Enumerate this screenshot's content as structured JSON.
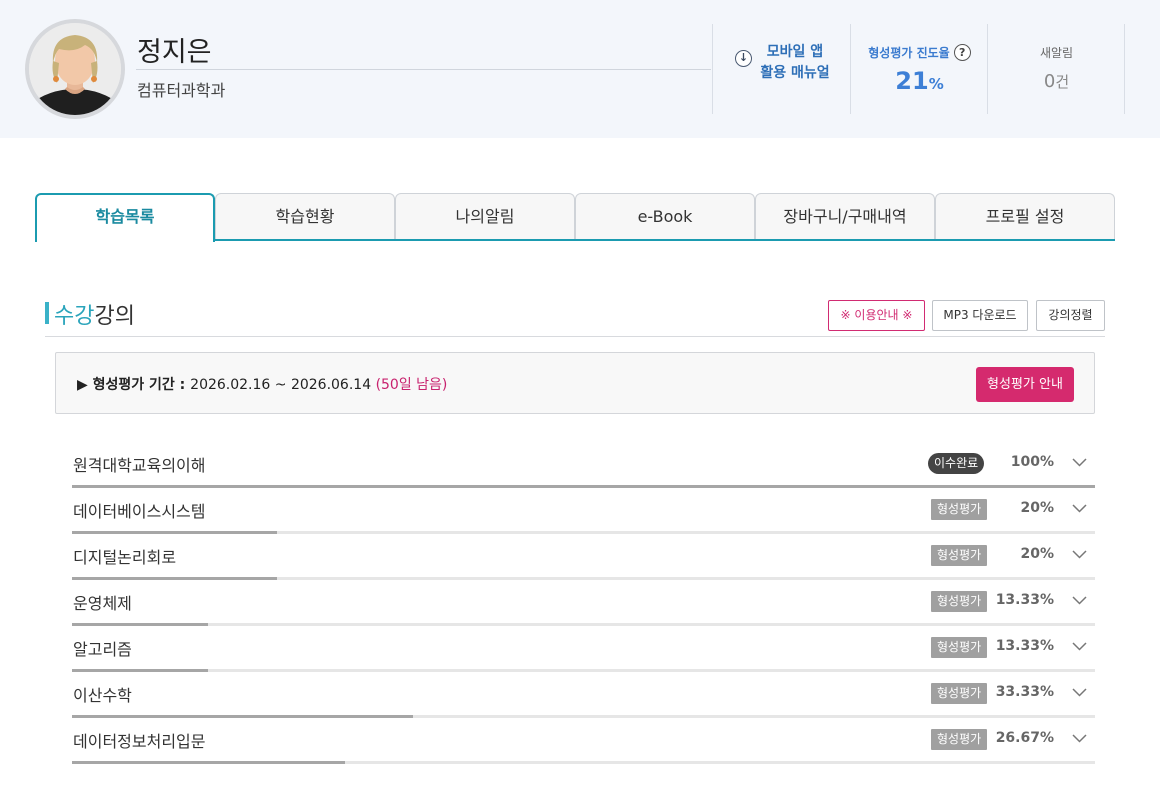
{
  "profile": {
    "name": "정지은",
    "department": "컴퓨터과학과"
  },
  "mobile_manual": {
    "line1": "모바일 앱",
    "line2": "활용 매뉴얼",
    "icon": "download-circle-icon"
  },
  "progress": {
    "label": "형성평가 진도율",
    "value": "21",
    "unit": "%"
  },
  "notifications": {
    "label": "새알림",
    "value": "0",
    "unit": "건"
  },
  "tabs": [
    {
      "label": "학습목록",
      "active": true
    },
    {
      "label": "학습현황",
      "active": false
    },
    {
      "label": "나의알림",
      "active": false
    },
    {
      "label": "e-Book",
      "active": false
    },
    {
      "label": "장바구니/구매내역",
      "active": false
    },
    {
      "label": "프로필 설정",
      "active": false
    }
  ],
  "section": {
    "title_accent": "수강",
    "title_rest": "강의",
    "btn_guide": "※ 이용안내 ※",
    "btn_mp3": "MP3 다운로드",
    "btn_sort": "강의정렬"
  },
  "period": {
    "label": "▶ 형성평가 기간 : ",
    "dates": "2026.02.16 ~ 2026.06.14 ",
    "remain": "(50일 남음)",
    "button": "형성평가 안내"
  },
  "courses": [
    {
      "name": "원격대학교육의이해",
      "badge": "이수완료",
      "badge_type": "done",
      "percent_text": "100%",
      "progress": 1.0
    },
    {
      "name": "데이터베이스시스템",
      "badge": "형성평가",
      "badge_type": "eval",
      "percent_text": "20%",
      "progress": 0.2
    },
    {
      "name": "디지털논리회로",
      "badge": "형성평가",
      "badge_type": "eval",
      "percent_text": "20%",
      "progress": 0.2
    },
    {
      "name": "운영체제",
      "badge": "형성평가",
      "badge_type": "eval",
      "percent_text": "13.33%",
      "progress": 0.1333
    },
    {
      "name": "알고리즘",
      "badge": "형성평가",
      "badge_type": "eval",
      "percent_text": "13.33%",
      "progress": 0.1333
    },
    {
      "name": "이산수학",
      "badge": "형성평가",
      "badge_type": "eval",
      "percent_text": "33.33%",
      "progress": 0.3333
    },
    {
      "name": "데이터정보처리입문",
      "badge": "형성평가",
      "badge_type": "eval",
      "percent_text": "26.67%",
      "progress": 0.2667
    }
  ],
  "colors": {
    "accent_teal": "#1b9bb0",
    "accent_pink": "#d52a6e",
    "progress_blue": "#3d7fd6"
  }
}
